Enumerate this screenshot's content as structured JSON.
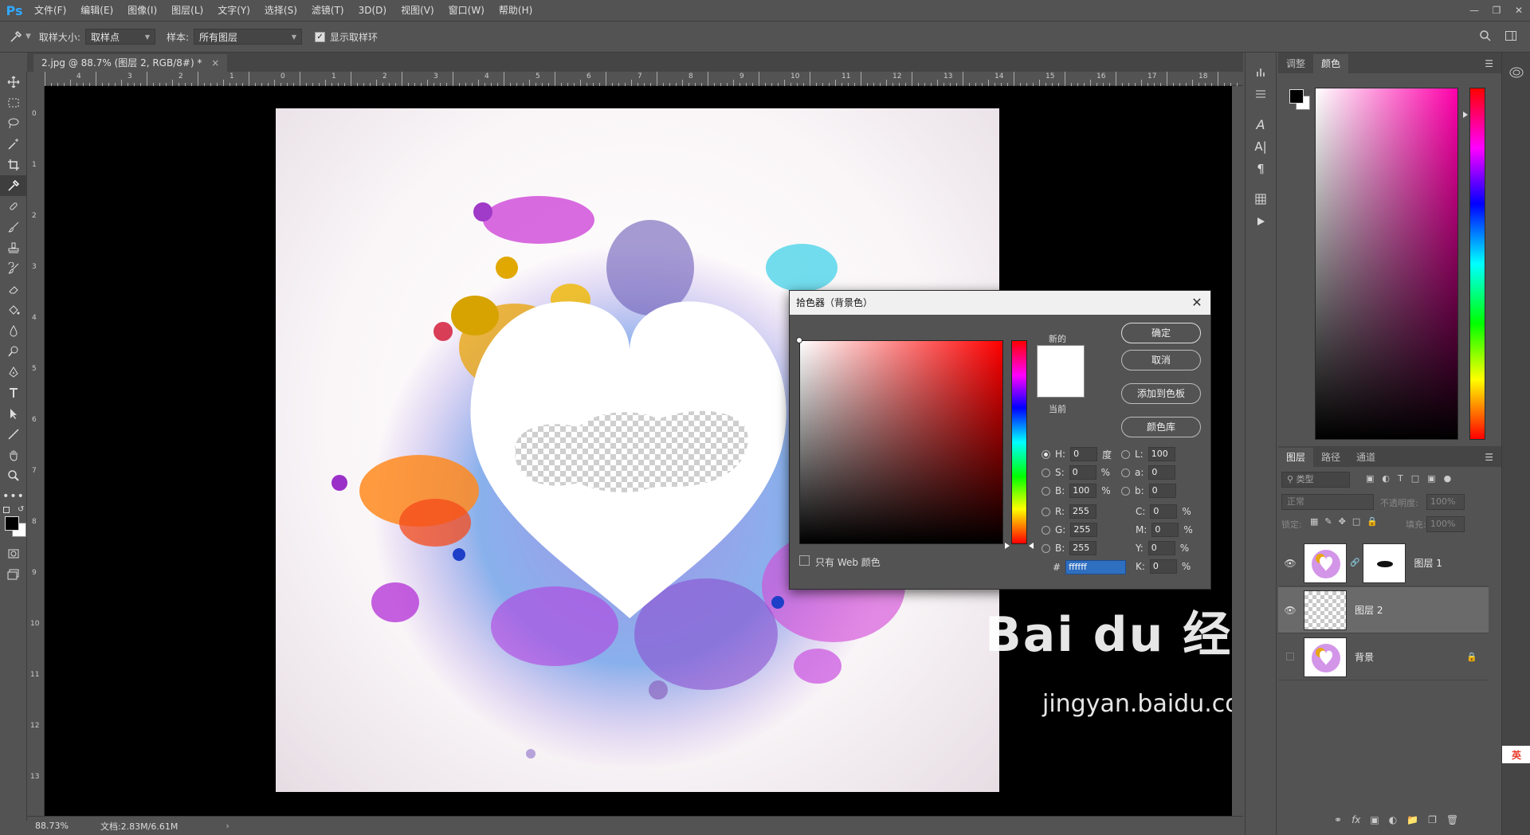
{
  "app": {
    "logo": "Ps"
  },
  "menu": [
    "文件(F)",
    "编辑(E)",
    "图像(I)",
    "图层(L)",
    "文字(Y)",
    "选择(S)",
    "滤镜(T)",
    "3D(D)",
    "视图(V)",
    "窗口(W)",
    "帮助(H)"
  ],
  "options": {
    "sample_size_label": "取样大小:",
    "sample_size_value": "取样点",
    "sample_label": "样本:",
    "sample_value": "所有图层",
    "show_ring_label": "显示取样环"
  },
  "document": {
    "tab_title": "2.jpg @ 88.7% (图层 2, RGB/8#) *",
    "close": "×"
  },
  "ruler_top": [
    "4",
    "3",
    "2",
    "1",
    "0",
    "1",
    "2",
    "3",
    "4",
    "5",
    "6",
    "7",
    "8",
    "9",
    "10",
    "11",
    "12",
    "13",
    "14",
    "15",
    "16",
    "17",
    "18"
  ],
  "ruler_left": [
    "0",
    "1",
    "2",
    "3",
    "4",
    "5",
    "6",
    "7",
    "8",
    "9",
    "10",
    "11",
    "12",
    "13"
  ],
  "status": {
    "zoom": "88.73%",
    "doc_info": "文档:2.83M/6.61M",
    "arrow": "›"
  },
  "panels": {
    "color_tabs": [
      "调整",
      "颜色"
    ],
    "layers_tabs": [
      "图层",
      "路径",
      "通道"
    ],
    "layer_kind": "类型",
    "blend_mode": "正常",
    "opacity_label": "不透明度:",
    "opacity_value": "100%",
    "lock_label": "锁定:",
    "fill_label": "填充:",
    "fill_value": "100%",
    "layers": [
      {
        "name": "图层 1",
        "visible": true
      },
      {
        "name": "图层 2",
        "visible": true
      },
      {
        "name": "背景",
        "visible": false
      }
    ],
    "footer_icons": [
      "link-icon",
      "fx-icon",
      "mask-icon",
      "adjustment-icon",
      "folder-icon",
      "new-layer-icon",
      "trash-icon"
    ],
    "fx_label": "fx"
  },
  "picker": {
    "title": "拾色器（背景色）",
    "ok": "确定",
    "cancel": "取消",
    "add_swatch": "添加到色板",
    "color_lib": "颜色库",
    "new_label": "新的",
    "current_label": "当前",
    "web_only": "只有 Web 颜色",
    "H": {
      "label": "H:",
      "value": "0",
      "unit": "度"
    },
    "S": {
      "label": "S:",
      "value": "0",
      "unit": "%"
    },
    "Bv": {
      "label": "B:",
      "value": "100",
      "unit": "%"
    },
    "R": {
      "label": "R:",
      "value": "255"
    },
    "G": {
      "label": "G:",
      "value": "255"
    },
    "Bc": {
      "label": "B:",
      "value": "255"
    },
    "L": {
      "label": "L:",
      "value": "100"
    },
    "a": {
      "label": "a:",
      "value": "0"
    },
    "b": {
      "label": "b:",
      "value": "0"
    },
    "C": {
      "label": "C:",
      "value": "0",
      "unit": "%"
    },
    "M": {
      "label": "M:",
      "value": "0",
      "unit": "%"
    },
    "Y": {
      "label": "Y:",
      "value": "0",
      "unit": "%"
    },
    "K": {
      "label": "K:",
      "value": "0",
      "unit": "%"
    },
    "hex_label": "#",
    "hex": "ffffff"
  },
  "watermark": {
    "text": "Bai du 经验",
    "url": "jingyan.baidu.com"
  },
  "ime": {
    "label": "英"
  },
  "colors": {
    "foreground": "#000000",
    "background": "#ffffff",
    "accent": "#31a8ff"
  }
}
